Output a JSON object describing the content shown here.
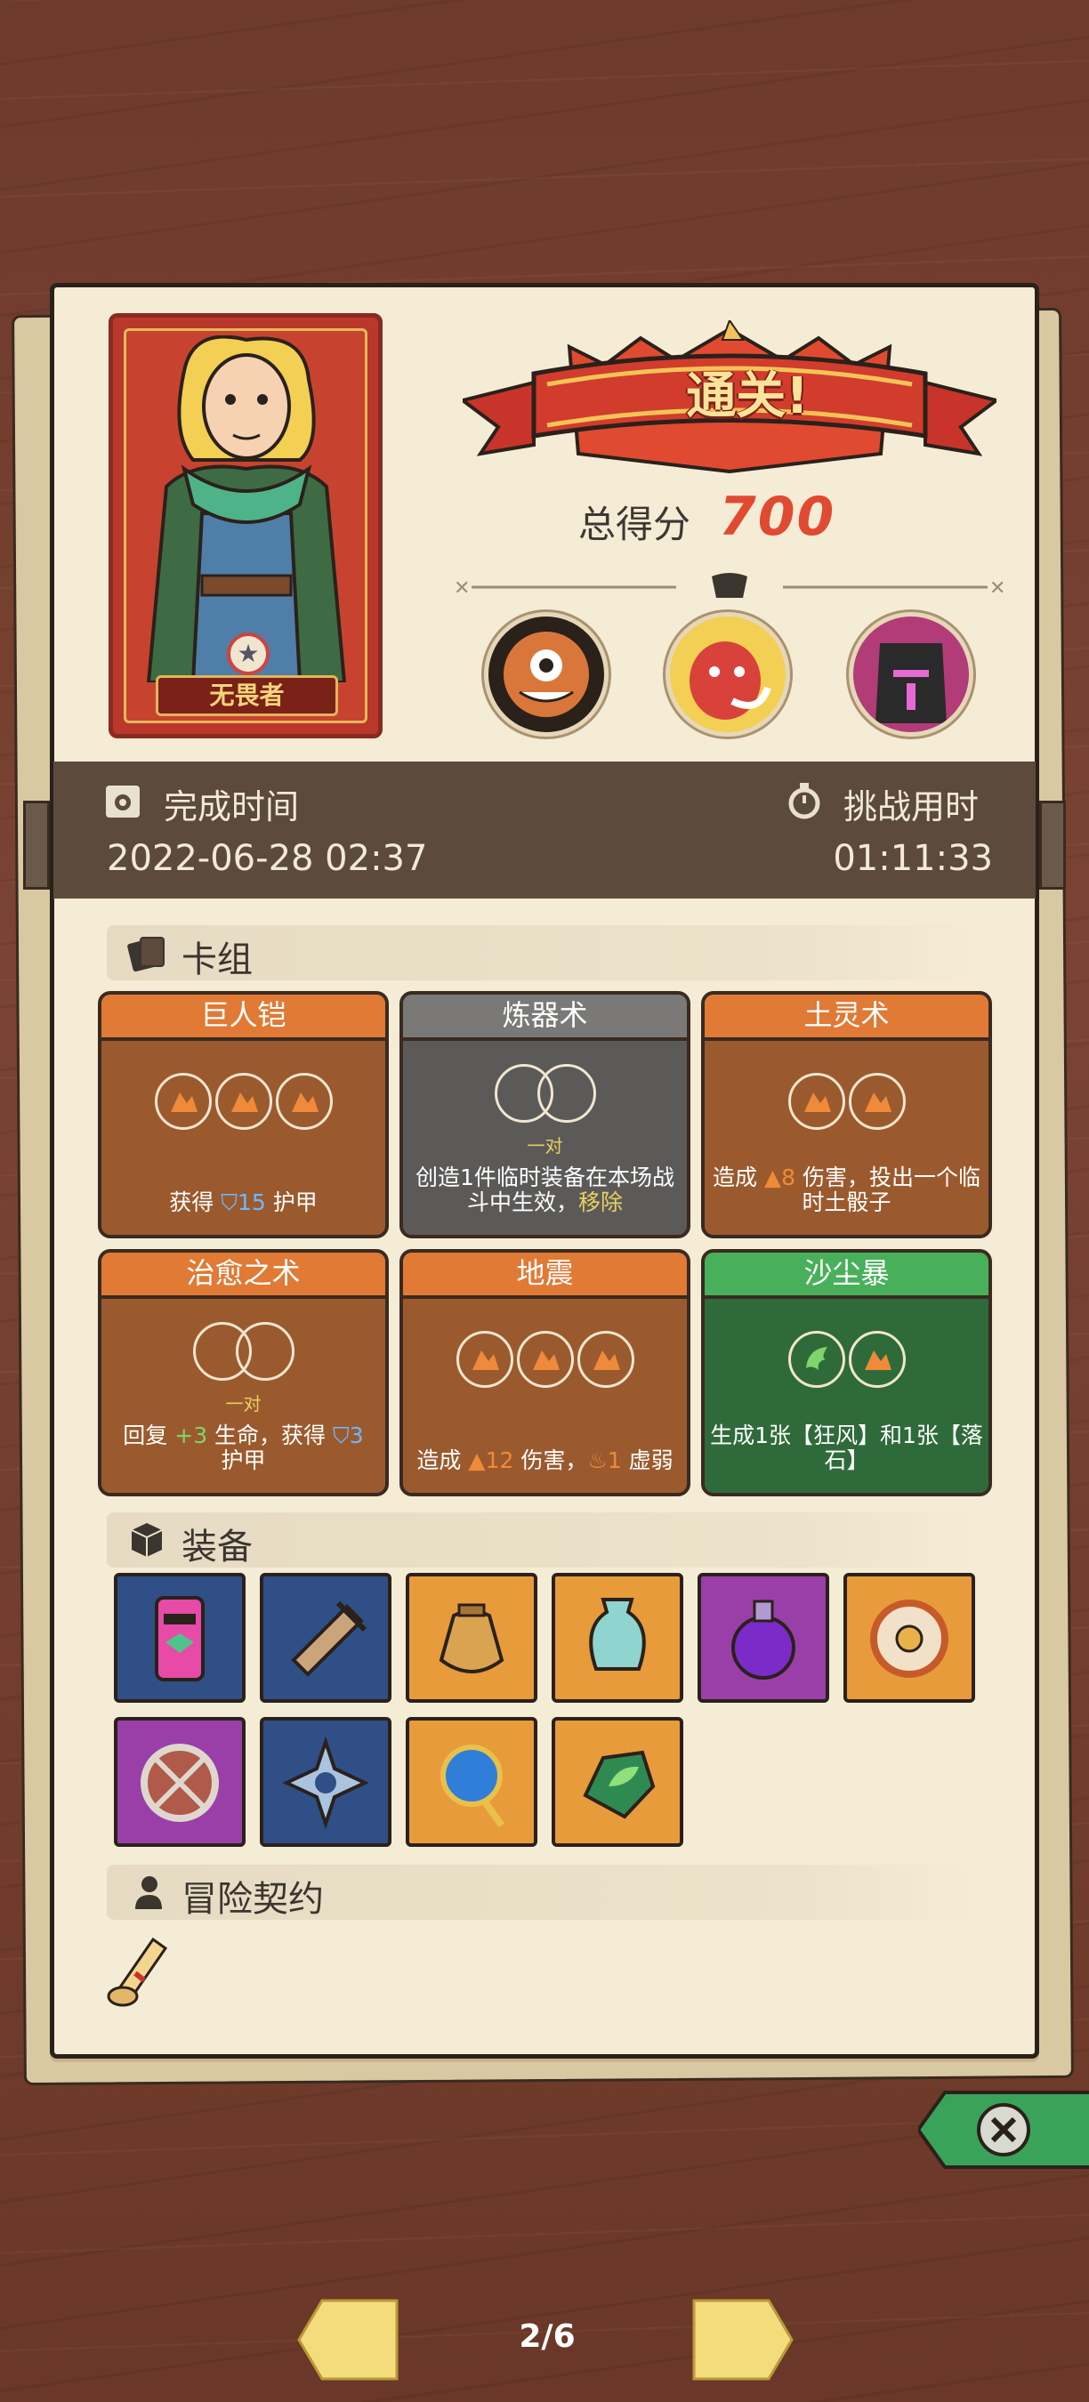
{
  "hero": {
    "name": "无畏者"
  },
  "banner": {
    "title": "通关!"
  },
  "score": {
    "label": "总得分",
    "value": "700"
  },
  "bosses": [
    "cyclops-boss-icon",
    "red-horned-boss-icon",
    "dark-knight-boss-icon"
  ],
  "time": {
    "completed_label": "完成时间",
    "completed_value": "2022-06-28 02:37",
    "challenge_label": "挑战用时",
    "challenge_value": "01:11:33"
  },
  "deck": {
    "title": "卡组",
    "cards": [
      {
        "name": "巨人铠",
        "desc_pre": "获得 ",
        "desc_val": "15",
        "desc_post": " 护甲"
      },
      {
        "name": "炼器术",
        "pair_label": "一对",
        "desc": "创造1件临时装备在本场战斗中生效，",
        "desc_link": "移除"
      },
      {
        "name": "土灵术",
        "desc_pre": "造成 ",
        "desc_val": "8",
        "desc_post": " 伤害，投出一个临时土骰子"
      },
      {
        "name": "治愈之术",
        "pair_label": "一对",
        "desc_a": "回复 ",
        "desc_b": "+3",
        "desc_c": " 生命，获得 ",
        "desc_d": "3",
        "desc_e": "护甲"
      },
      {
        "name": "地震",
        "desc_pre": "造成 ",
        "desc_val": "12",
        "desc_mid": " 伤害，",
        "desc_val2": "1",
        "desc_post": " 虚弱"
      },
      {
        "name": "沙尘暴",
        "desc": "生成1张【狂风】和1张【落石】"
      }
    ]
  },
  "equipment": {
    "title": "装备",
    "items": [
      "totem-icon",
      "horn-icon",
      "money-bag-icon",
      "vase-icon",
      "potion-icon",
      "ring-icon",
      "shield-icon",
      "gear-icon",
      "orb-icon",
      "leaf-stone-icon"
    ]
  },
  "contract": {
    "title": "冒险契约"
  },
  "pager": {
    "text": "2/6"
  },
  "colors": {
    "accent": "#e04a31",
    "card_orange": "#e07a35",
    "card_green": "#48b05a",
    "band": "#5c4a3d"
  }
}
